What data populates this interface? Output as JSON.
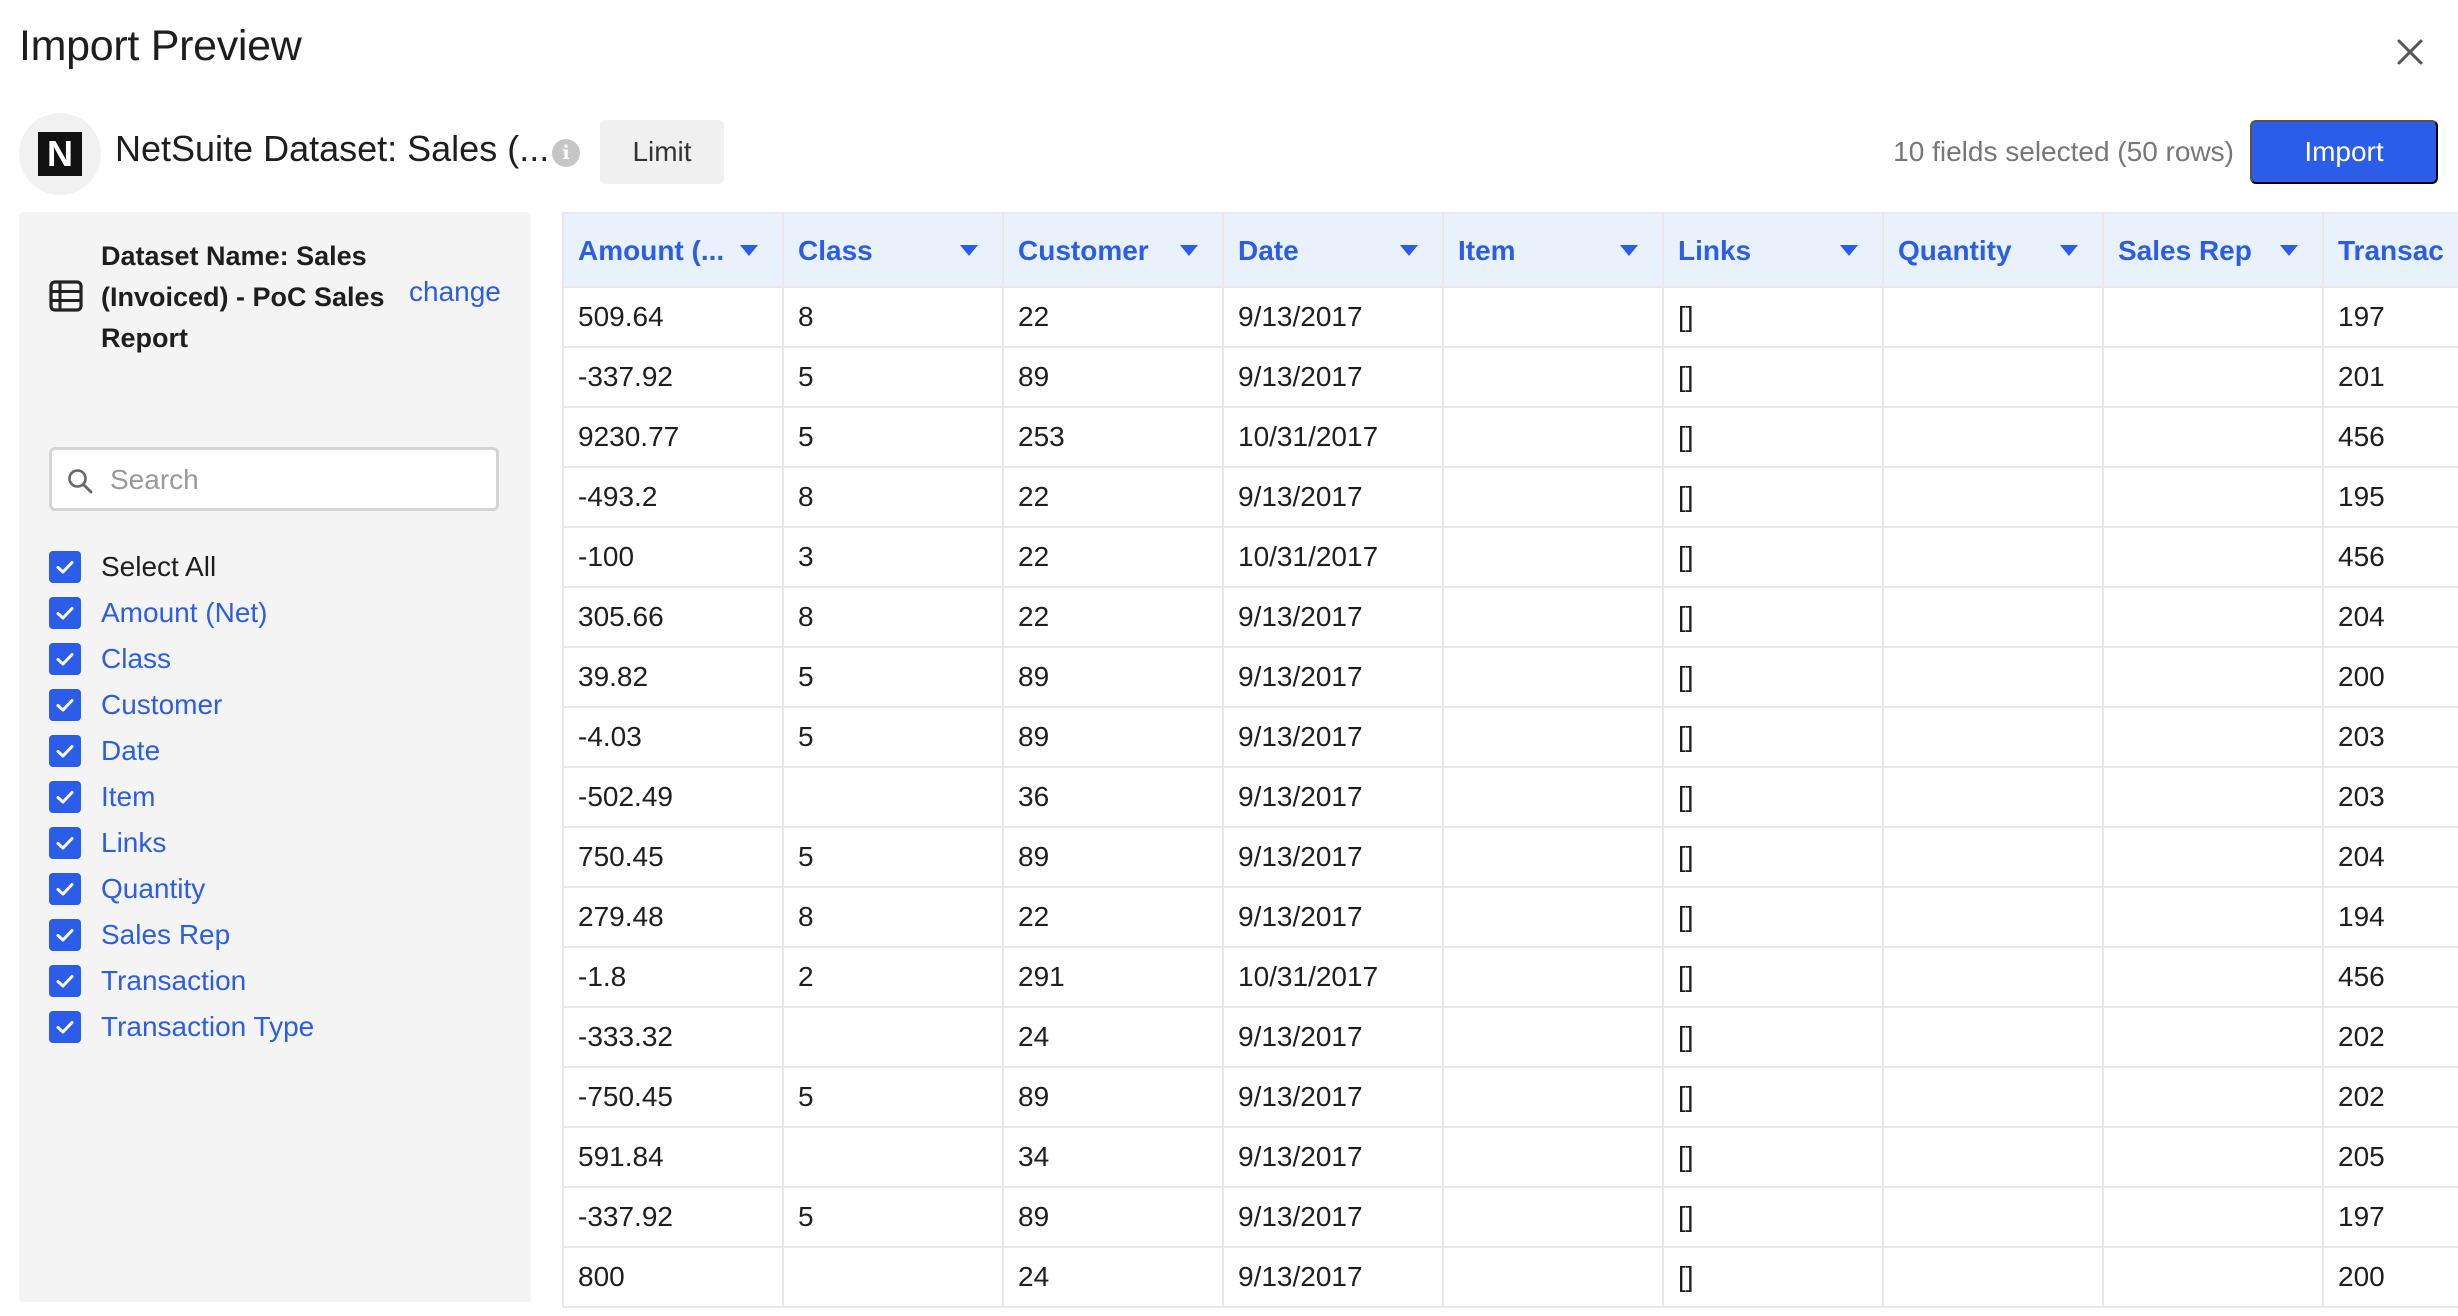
{
  "dialog": {
    "title": "Import Preview",
    "close_icon": "close-icon"
  },
  "source": {
    "logo_letter": "N",
    "title": "NetSuite Dataset: Sales (...",
    "info_icon_glyph": "i",
    "limit_label": "Limit",
    "fields_summary": "10 fields selected (50 rows)",
    "import_label": "Import"
  },
  "sidebar": {
    "dataset_name": "Dataset Name: Sales (Invoiced) - PoC Sales Report",
    "change_label": "change",
    "search_placeholder": "Search",
    "select_all_label": "Select All",
    "fields": [
      "Amount (Net)",
      "Class",
      "Customer",
      "Date",
      "Item",
      "Links",
      "Quantity",
      "Sales Rep",
      "Transaction",
      "Transaction Type"
    ]
  },
  "table": {
    "headers": [
      "Amount (...",
      "Class",
      "Customer",
      "Date",
      "Item",
      "Links",
      "Quantity",
      "Sales Rep",
      "Transac"
    ],
    "rows": [
      [
        "509.64",
        "8",
        "22",
        "9/13/2017",
        "",
        "[]",
        "",
        "",
        "197"
      ],
      [
        "-337.92",
        "5",
        "89",
        "9/13/2017",
        "",
        "[]",
        "",
        "",
        "201"
      ],
      [
        "9230.77",
        "5",
        "253",
        "10/31/2017",
        "",
        "[]",
        "",
        "",
        "456"
      ],
      [
        "-493.2",
        "8",
        "22",
        "9/13/2017",
        "",
        "[]",
        "",
        "",
        "195"
      ],
      [
        "-100",
        "3",
        "22",
        "10/31/2017",
        "",
        "[]",
        "",
        "",
        "456"
      ],
      [
        "305.66",
        "8",
        "22",
        "9/13/2017",
        "",
        "[]",
        "",
        "",
        "204"
      ],
      [
        "39.82",
        "5",
        "89",
        "9/13/2017",
        "",
        "[]",
        "",
        "",
        "200"
      ],
      [
        "-4.03",
        "5",
        "89",
        "9/13/2017",
        "",
        "[]",
        "",
        "",
        "203"
      ],
      [
        "-502.49",
        "",
        "36",
        "9/13/2017",
        "",
        "[]",
        "",
        "",
        "203"
      ],
      [
        "750.45",
        "5",
        "89",
        "9/13/2017",
        "",
        "[]",
        "",
        "",
        "204"
      ],
      [
        "279.48",
        "8",
        "22",
        "9/13/2017",
        "",
        "[]",
        "",
        "",
        "194"
      ],
      [
        "-1.8",
        "2",
        "291",
        "10/31/2017",
        "",
        "[]",
        "",
        "",
        "456"
      ],
      [
        "-333.32",
        "",
        "24",
        "9/13/2017",
        "",
        "[]",
        "",
        "",
        "202"
      ],
      [
        "-750.45",
        "5",
        "89",
        "9/13/2017",
        "",
        "[]",
        "",
        "",
        "202"
      ],
      [
        "591.84",
        "",
        "34",
        "9/13/2017",
        "",
        "[]",
        "",
        "",
        "205"
      ],
      [
        "-337.92",
        "5",
        "89",
        "9/13/2017",
        "",
        "[]",
        "",
        "",
        "197"
      ],
      [
        "800",
        "",
        "24",
        "9/13/2017",
        "",
        "[]",
        "",
        "",
        "200"
      ]
    ]
  },
  "colors": {
    "accent": "#2b5de8",
    "header_bg": "#e9f1fc",
    "sidebar_bg": "#f4f4f4"
  }
}
